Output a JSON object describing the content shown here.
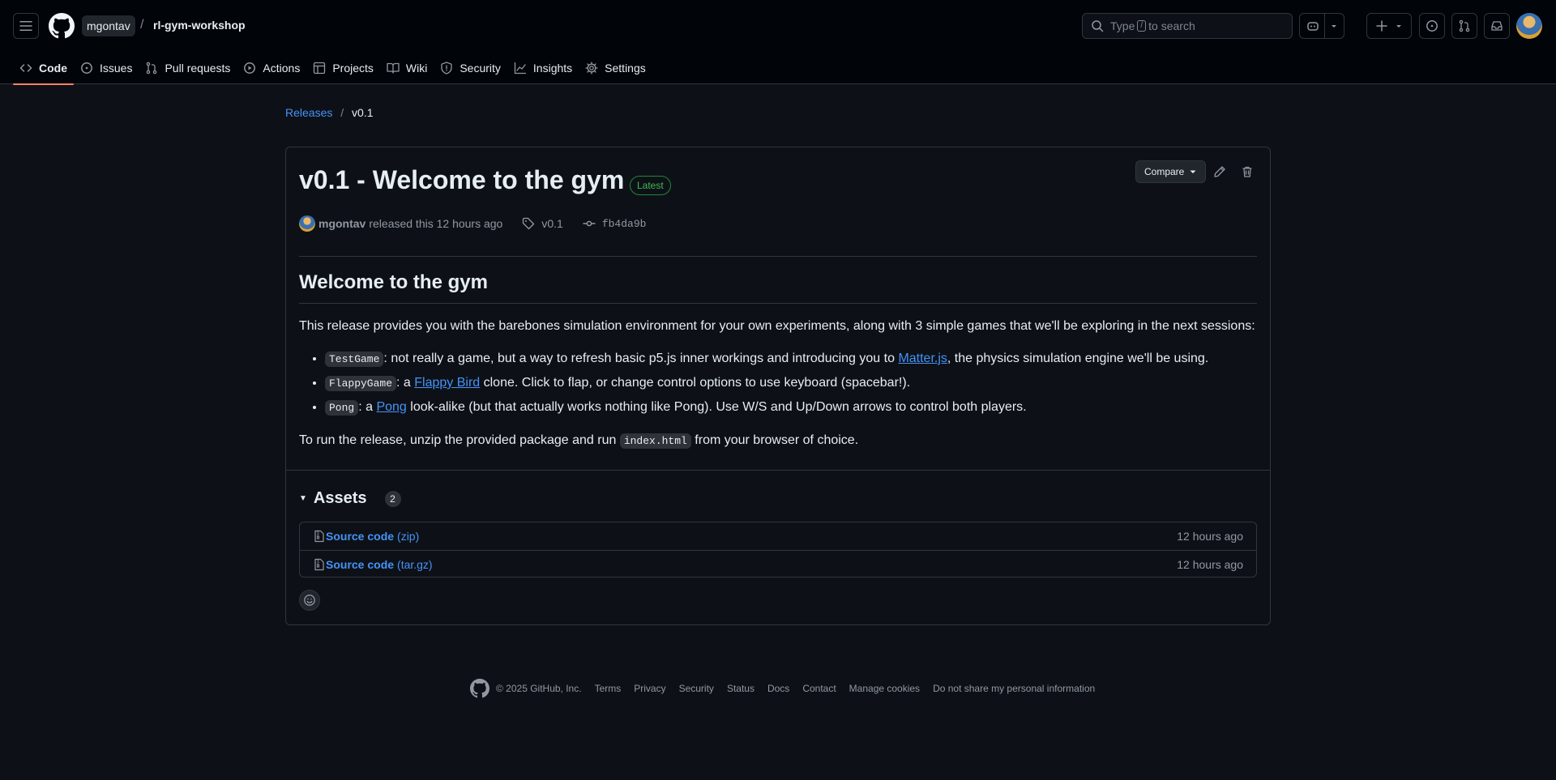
{
  "header": {
    "owner": "mgontav",
    "separator": "/",
    "repo": "rl-gym-workshop",
    "search": {
      "prefix": "Type",
      "key": "/",
      "suffix": "to search"
    }
  },
  "nav": {
    "items": [
      {
        "label": "Code",
        "icon": "code-icon",
        "active": true
      },
      {
        "label": "Issues",
        "icon": "issue-opened-icon"
      },
      {
        "label": "Pull requests",
        "icon": "git-pull-request-icon"
      },
      {
        "label": "Actions",
        "icon": "play-icon"
      },
      {
        "label": "Projects",
        "icon": "table-icon"
      },
      {
        "label": "Wiki",
        "icon": "book-icon"
      },
      {
        "label": "Security",
        "icon": "shield-icon"
      },
      {
        "label": "Insights",
        "icon": "graph-icon"
      },
      {
        "label": "Settings",
        "icon": "gear-icon"
      }
    ]
  },
  "breadcrumb": {
    "root": "Releases",
    "separator": "/",
    "current": "v0.1"
  },
  "release": {
    "title": "v0.1 - Welcome to the gym",
    "badge": "Latest",
    "compare_label": "Compare",
    "author": "mgontav",
    "released_text": "released this 12 hours ago",
    "tag": "v0.1",
    "commit": "fb4da9b",
    "body": {
      "heading": "Welcome to the gym",
      "intro": "This release provides you with the barebones simulation environment for your own experiments, along with 3 simple games that we'll be exploring in the next sessions:",
      "items": [
        {
          "code": "TestGame",
          "pre": ": not really a game, but a way to refresh basic p5.js inner workings and introducing you to ",
          "link": "Matter.js",
          "post": ", the physics simulation engine we'll be using."
        },
        {
          "code": "FlappyGame",
          "pre": ": a ",
          "link": "Flappy Bird",
          "post": " clone. Click to flap, or change control options to use keyboard (spacebar!)."
        },
        {
          "code": "Pong",
          "pre": ": a ",
          "link": "Pong",
          "post": " look-alike (but that actually works nothing like Pong). Use W/S and Up/Down arrows to control both players."
        }
      ],
      "run_pre": "To run the release, unzip the provided package and run ",
      "run_code": "index.html",
      "run_post": " from your browser of choice."
    },
    "assets": {
      "label": "Assets",
      "count": "2",
      "items": [
        {
          "name": "Source code",
          "ext": "(zip)",
          "time": "12 hours ago"
        },
        {
          "name": "Source code",
          "ext": "(tar.gz)",
          "time": "12 hours ago"
        }
      ]
    }
  },
  "footer": {
    "copyright": "© 2025 GitHub, Inc.",
    "links": [
      "Terms",
      "Privacy",
      "Security",
      "Status",
      "Docs",
      "Contact",
      "Manage cookies",
      "Do not share my personal information"
    ]
  },
  "colors": {
    "background": "#0d1117",
    "header_bg": "#010409",
    "link": "#4493f8",
    "active_underline": "#f78166",
    "latest_badge": "#3fb950",
    "border": "#30363d"
  }
}
